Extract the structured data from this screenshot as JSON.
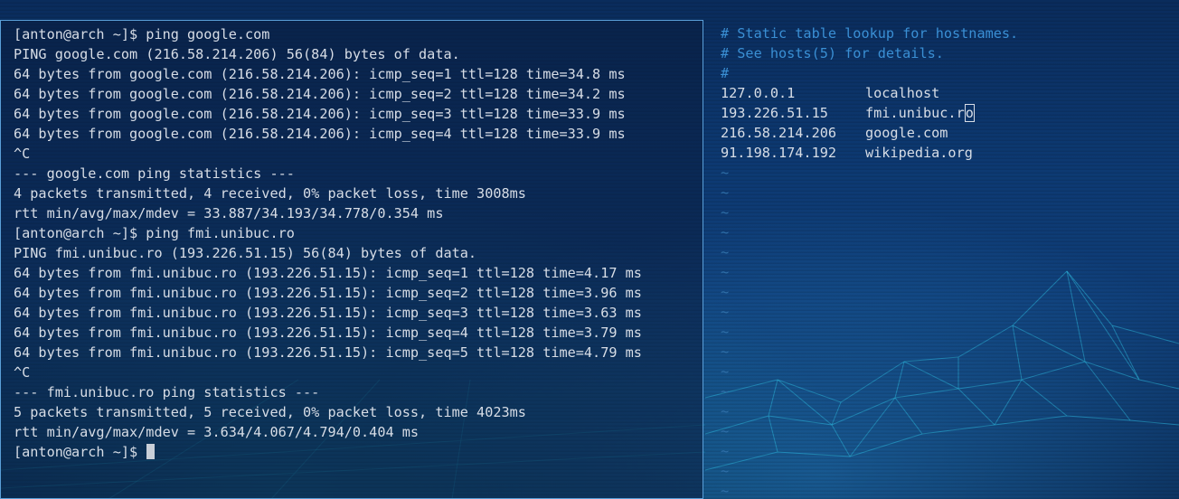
{
  "terminal": {
    "lines": [
      "[anton@arch ~]$ ping google.com",
      "PING google.com (216.58.214.206) 56(84) bytes of data.",
      "64 bytes from google.com (216.58.214.206): icmp_seq=1 ttl=128 time=34.8 ms",
      "64 bytes from google.com (216.58.214.206): icmp_seq=2 ttl=128 time=34.2 ms",
      "64 bytes from google.com (216.58.214.206): icmp_seq=3 ttl=128 time=33.9 ms",
      "64 bytes from google.com (216.58.214.206): icmp_seq=4 ttl=128 time=33.9 ms",
      "^C",
      "--- google.com ping statistics ---",
      "4 packets transmitted, 4 received, 0% packet loss, time 3008ms",
      "rtt min/avg/max/mdev = 33.887/34.193/34.778/0.354 ms",
      "[anton@arch ~]$ ping fmi.unibuc.ro",
      "PING fmi.unibuc.ro (193.226.51.15) 56(84) bytes of data.",
      "64 bytes from fmi.unibuc.ro (193.226.51.15): icmp_seq=1 ttl=128 time=4.17 ms",
      "64 bytes from fmi.unibuc.ro (193.226.51.15): icmp_seq=2 ttl=128 time=3.96 ms",
      "64 bytes from fmi.unibuc.ro (193.226.51.15): icmp_seq=3 ttl=128 time=3.63 ms",
      "64 bytes from fmi.unibuc.ro (193.226.51.15): icmp_seq=4 ttl=128 time=3.79 ms",
      "64 bytes from fmi.unibuc.ro (193.226.51.15): icmp_seq=5 ttl=128 time=4.79 ms",
      "^C",
      "--- fmi.unibuc.ro ping statistics ---",
      "5 packets transmitted, 5 received, 0% packet loss, time 4023ms",
      "rtt min/avg/max/mdev = 3.634/4.067/4.794/0.404 ms"
    ],
    "prompt": "[anton@arch ~]$ "
  },
  "editor": {
    "comments": [
      "# Static table lookup for hostnames.",
      "# See hosts(5) for details.",
      "#"
    ],
    "hosts": [
      {
        "ip": "127.0.0.1",
        "name": "localhost"
      },
      {
        "ip": "193.226.51.15",
        "name_before_cursor": "fmi.unibuc.r",
        "cursor_char": "o"
      },
      {
        "ip": "216.58.214.206",
        "name": "google.com"
      },
      {
        "ip": "91.198.174.192",
        "name": "wikipedia.org"
      }
    ],
    "empty_line_marker": "~",
    "tilde_count": 17
  },
  "colors": {
    "terminal_text": "#d7dde6",
    "comment": "#3a8fd4",
    "tilde": "#2f6fa8",
    "window_border": "#5a9fd8"
  }
}
